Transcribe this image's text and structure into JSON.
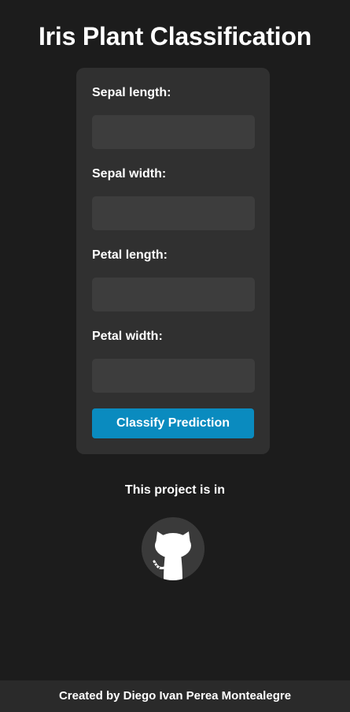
{
  "page": {
    "title": "Iris Plant Classification"
  },
  "form": {
    "fields": [
      {
        "label": "Sepal length:",
        "value": "",
        "placeholder": ""
      },
      {
        "label": "Sepal width:",
        "value": "",
        "placeholder": ""
      },
      {
        "label": "Petal length:",
        "value": "",
        "placeholder": ""
      },
      {
        "label": "Petal width:",
        "value": "",
        "placeholder": ""
      }
    ],
    "submit_label": "Classify Prediction"
  },
  "project": {
    "text": "This project is in",
    "icon": "github-icon"
  },
  "footer": {
    "text": "Created by Diego Ivan Perea Montealegre"
  },
  "colors": {
    "background": "#1c1c1c",
    "card": "#303030",
    "input": "#3d3d3d",
    "accent": "#0a8bbf",
    "footer": "#2a2a2a"
  }
}
